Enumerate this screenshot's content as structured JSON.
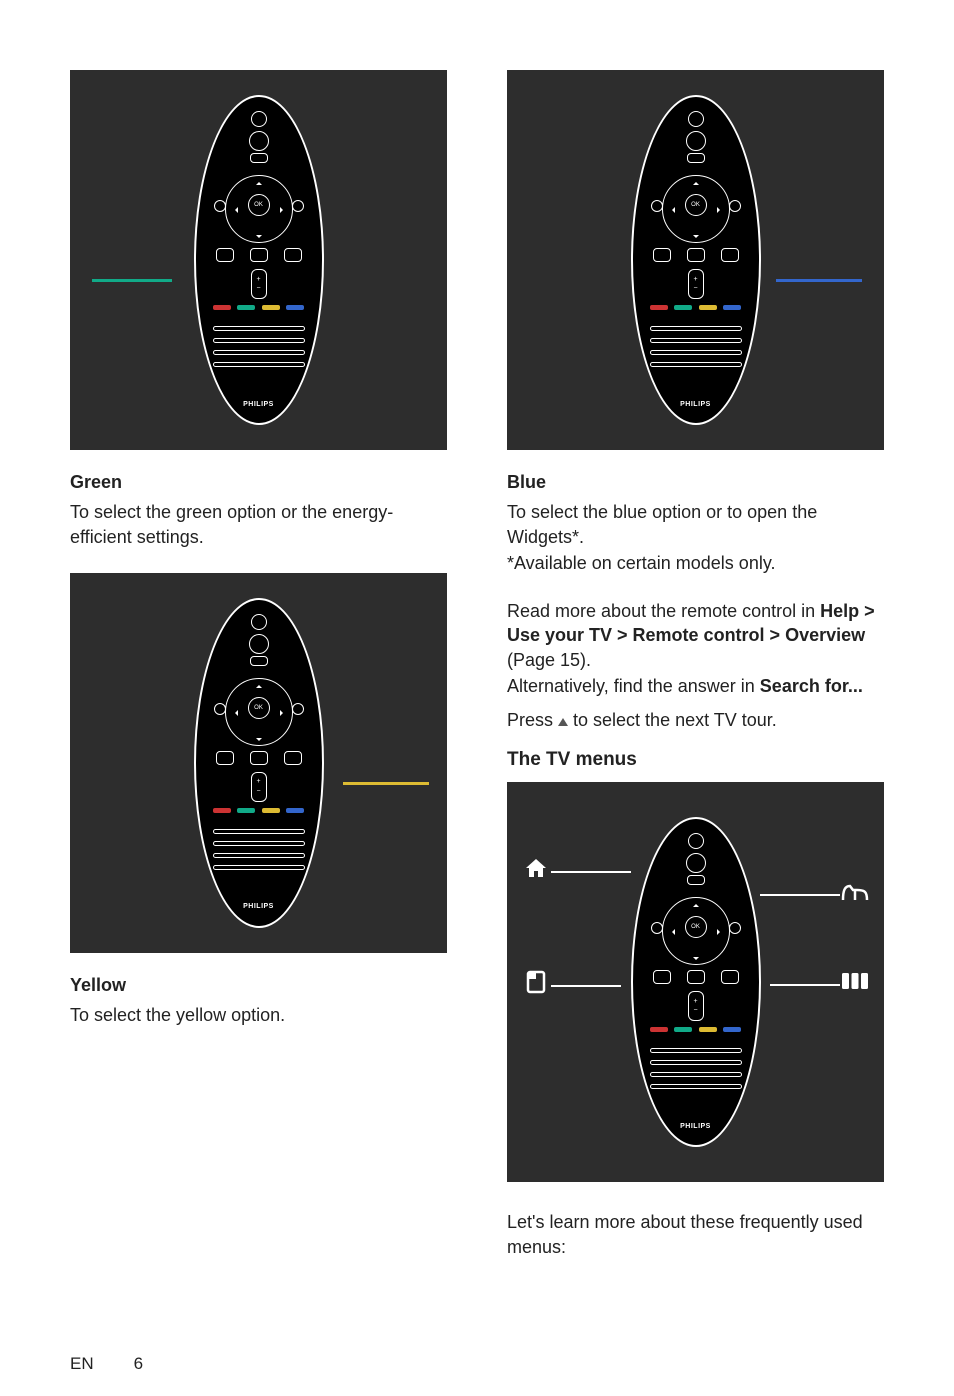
{
  "brand": "PHILIPS",
  "ok_label": "OK",
  "sections": {
    "green": {
      "title": "Green",
      "body": "To select the green option or the energy-efficient settings."
    },
    "yellow": {
      "title": "Yellow",
      "body": "To select the yellow option."
    },
    "blue": {
      "title": "Blue",
      "body1": "To select the blue option or to open the Widgets*.",
      "body2": "*Available on certain models only."
    },
    "read_more": {
      "intro": "Read more about the remote control in ",
      "path": "Help > Use your TV > Remote control > Overview",
      "page_ref": " (Page 15).",
      "alt_prefix": "Alternatively, find the answer in ",
      "alt_bold": "Search for...",
      "press_prefix": "Press ",
      "press_suffix": " to select the next TV tour."
    },
    "tv_menus": {
      "title": "The TV menus",
      "outro": "Let's learn more about these frequently used menus:"
    }
  },
  "footer": {
    "lang": "EN",
    "page": "6"
  }
}
